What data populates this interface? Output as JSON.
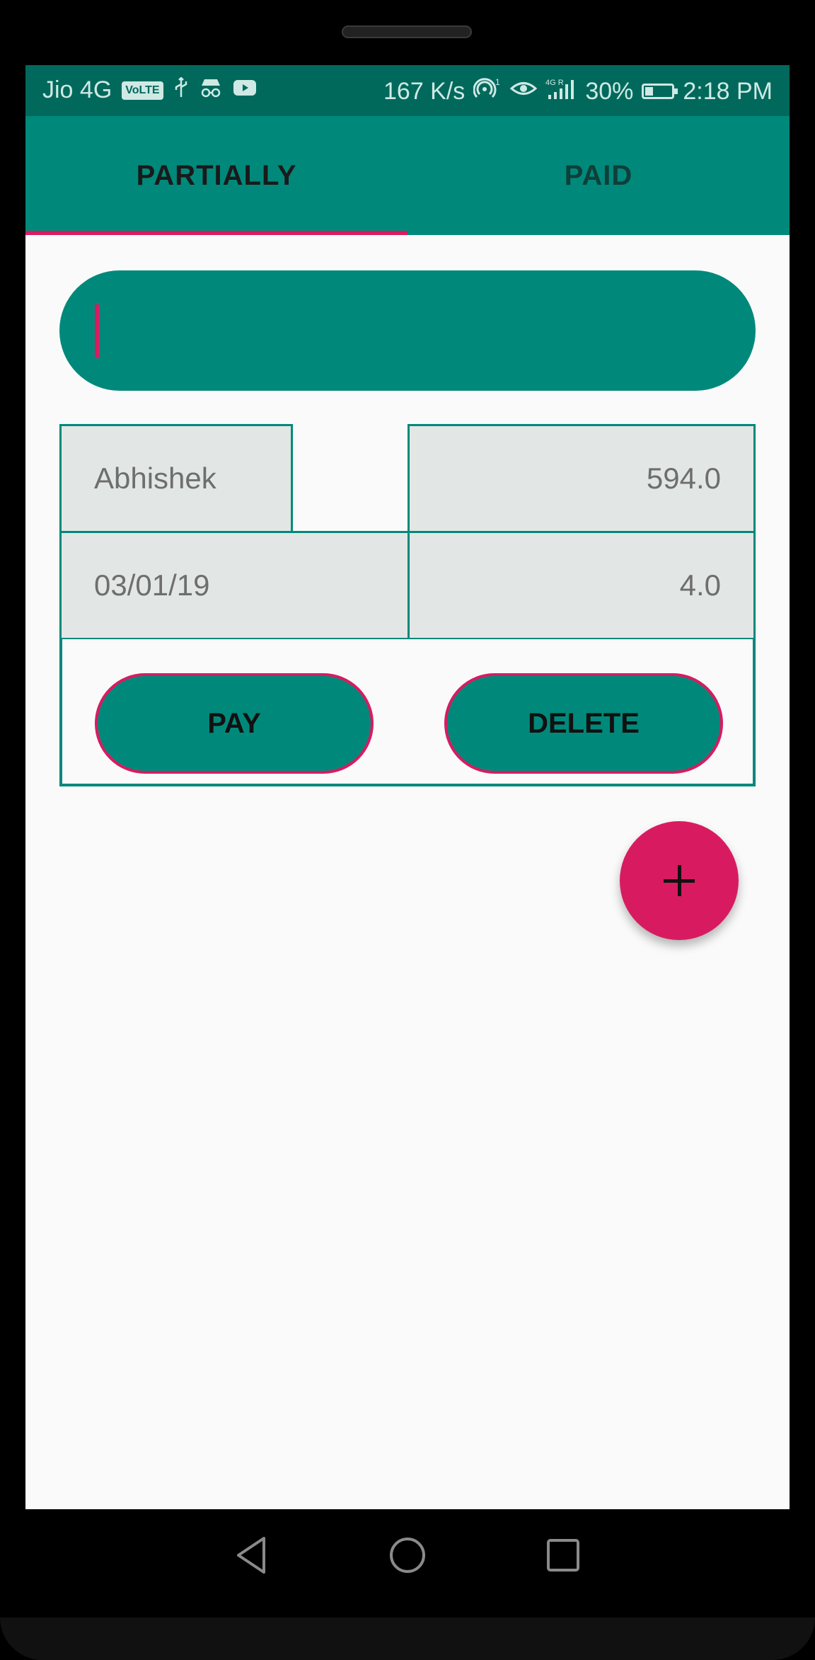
{
  "status_bar": {
    "carrier": "Jio 4G",
    "volte": "VoLTE",
    "speed": "167 K/s",
    "network": "4G R",
    "battery": "30%",
    "time": "2:18 PM",
    "icons": [
      "usb-icon",
      "incognito-icon",
      "youtube-icon",
      "hotspot-icon",
      "eye-icon",
      "signal-icon",
      "battery-charging-icon"
    ]
  },
  "tabs": [
    {
      "label": "PARTIALLY",
      "active": true
    },
    {
      "label": "PAID",
      "active": false
    }
  ],
  "search": {
    "value": "",
    "placeholder": ""
  },
  "record": {
    "name": "Abhishek",
    "total": "594.0",
    "date": "03/01/19",
    "paid": "4.0"
  },
  "actions": {
    "pay_label": "PAY",
    "delete_label": "DELETE"
  },
  "fab": {
    "icon": "plus-icon"
  },
  "nav": {
    "icons": [
      "back-icon",
      "home-icon",
      "recents-icon"
    ]
  },
  "colors": {
    "primary": "#00897b",
    "primary_dark": "#00695c",
    "accent": "#d81b60",
    "background": "#fafafa",
    "cell_background": "#e2e7e5"
  }
}
